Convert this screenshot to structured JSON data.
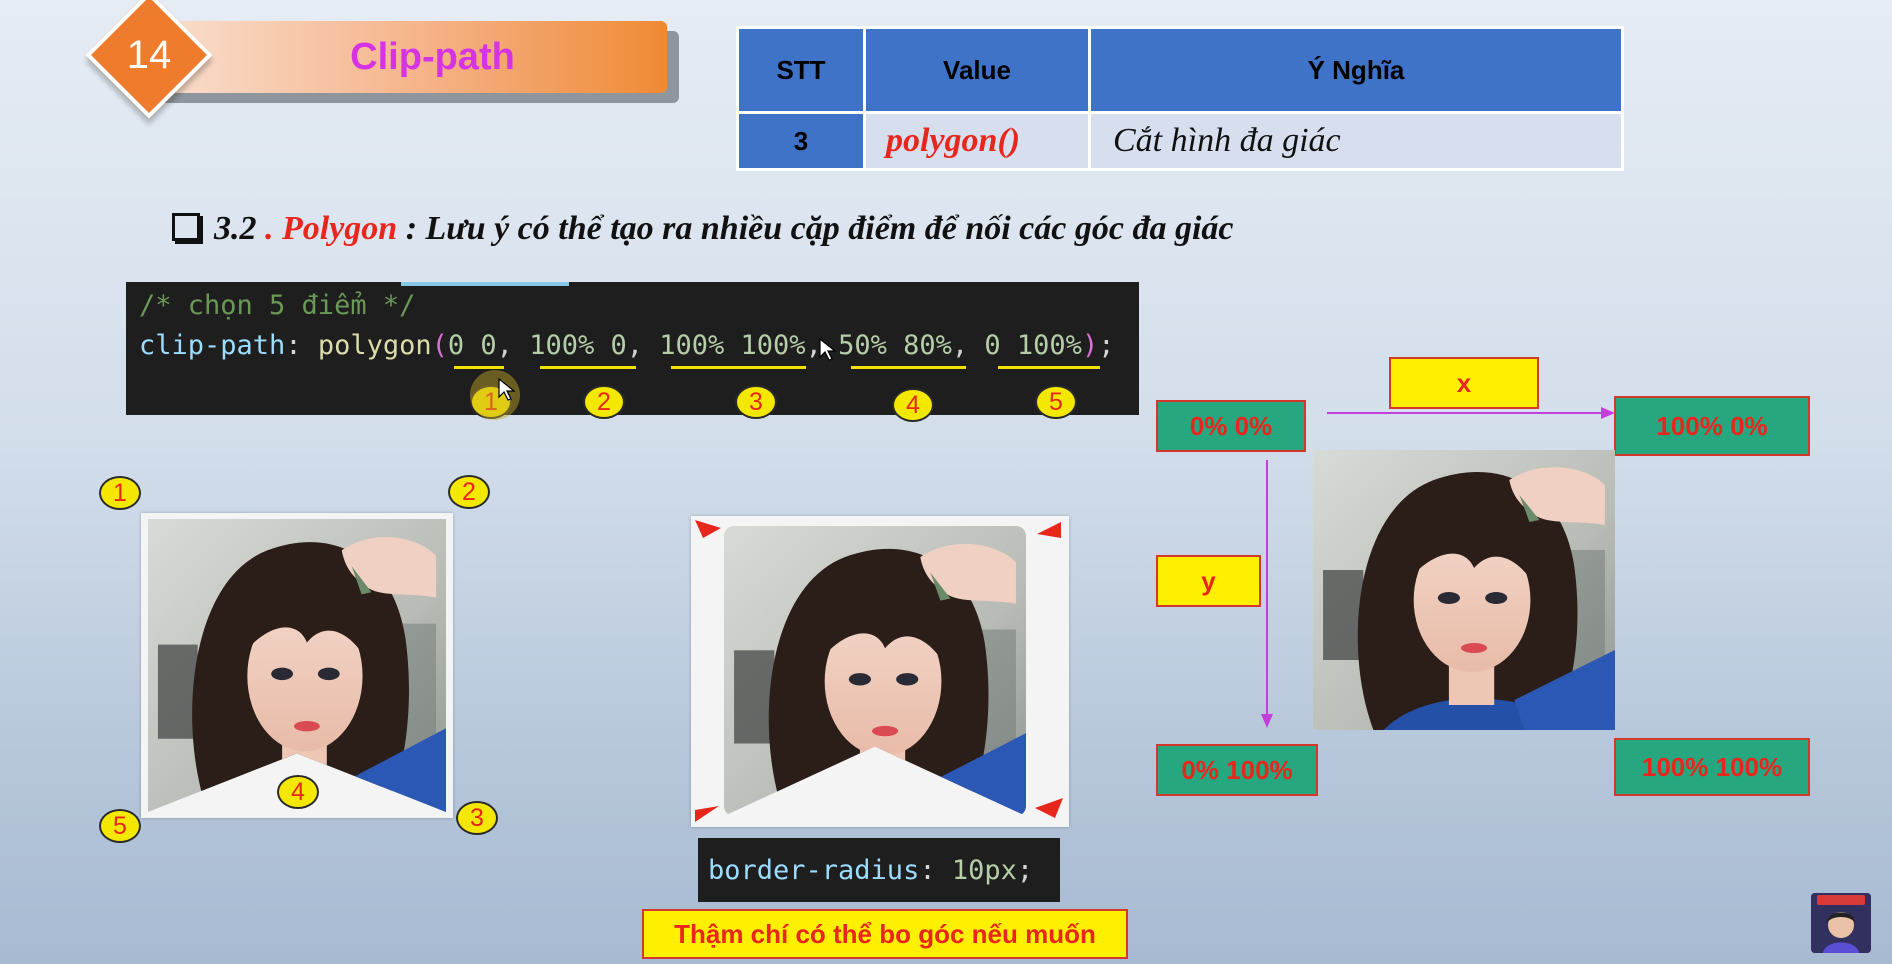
{
  "lesson": {
    "number": "14",
    "title": "Clip-path"
  },
  "table": {
    "headers": [
      "STT",
      "Value",
      "Ý Nghĩa"
    ],
    "rows": [
      {
        "stt": "3",
        "value": "polygon()",
        "meaning": "Cắt hình đa giác"
      }
    ]
  },
  "note": {
    "number": "3.2",
    "dot": ".",
    "keyword": "Polygon",
    "text": ": Lưu ý có thể tạo ra nhiều cặp điểm để nối các góc đa giác"
  },
  "code": {
    "comment": "/* chọn 5 điểm */",
    "property": "clip-path",
    "function": "polygon",
    "points": [
      "0 0",
      "100% 0",
      "100% 100%",
      "50% 80%",
      "0 100%"
    ]
  },
  "point_labels": [
    "1",
    "2",
    "3",
    "4",
    "5"
  ],
  "coords": {
    "top_left": "0% 0%",
    "top_right": "100% 0%",
    "bottom_left": "0% 100%",
    "bottom_right": "100% 100%",
    "x_axis": "x",
    "y_axis": "y"
  },
  "border_radius_code": {
    "property": "border-radius",
    "value": "10px"
  },
  "caption": "Thậm chí có thể bo góc nếu muốn",
  "colors": {
    "accent_orange": "#ef7b2d",
    "title_magenta": "#d633e4",
    "table_blue": "#3f73c8",
    "red": "#e8261c",
    "yellow": "#ffef00",
    "green": "#27a77f",
    "arrow_magenta": "#c23fd9"
  }
}
